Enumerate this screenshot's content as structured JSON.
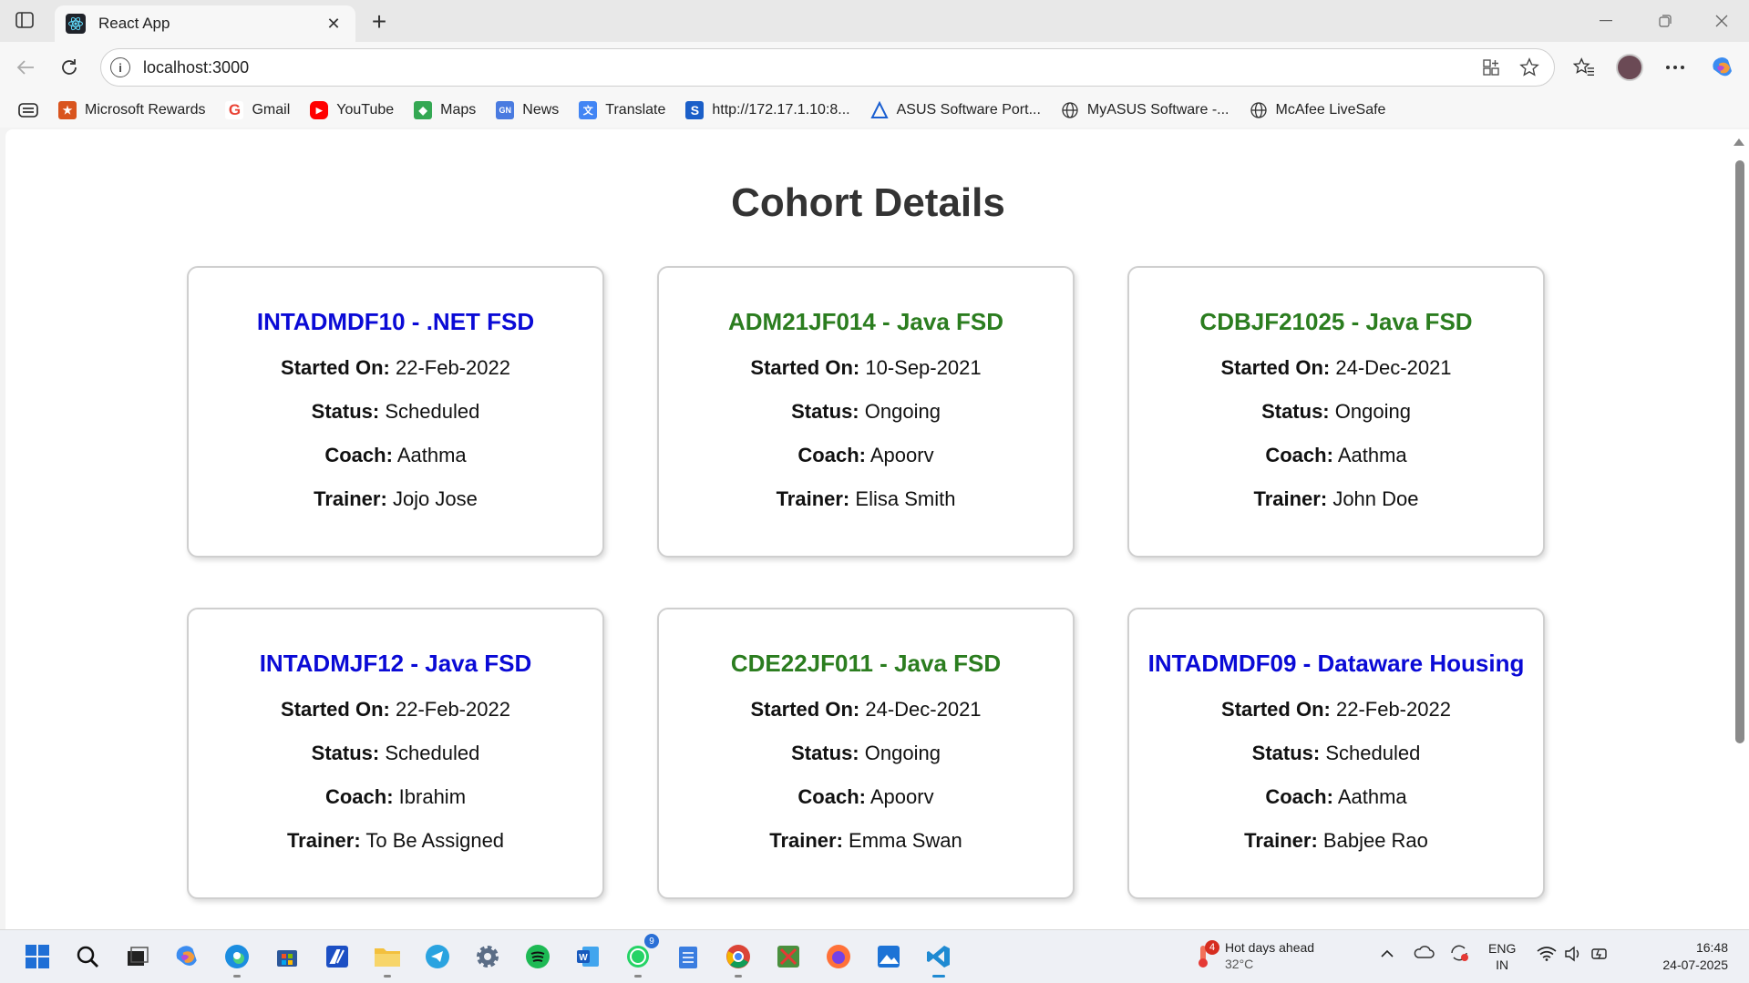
{
  "browser": {
    "tab_title": "React App",
    "url": "localhost:3000",
    "bookmarks": [
      {
        "label": "Microsoft Rewards",
        "icon": "rewards-icon",
        "color": "#d9541e"
      },
      {
        "label": "Gmail",
        "icon": "gmail-icon",
        "color": "#ea4335"
      },
      {
        "label": "YouTube",
        "icon": "youtube-icon",
        "color": "#ff0000"
      },
      {
        "label": "Maps",
        "icon": "maps-icon",
        "color": "#34a853"
      },
      {
        "label": "News",
        "icon": "news-icon",
        "color": "#4a7be0"
      },
      {
        "label": "Translate",
        "icon": "translate-icon",
        "color": "#4285f4"
      },
      {
        "label": "http://172.17.1.10:8...",
        "icon": "s-icon",
        "color": "#1b5fc8"
      },
      {
        "label": "ASUS Software Port...",
        "icon": "asus-icon",
        "color": "#1a5fd1"
      },
      {
        "label": "MyASUS Software -...",
        "icon": "globe-icon",
        "color": "#444444"
      },
      {
        "label": "McAfee LiveSafe",
        "icon": "globe-icon",
        "color": "#444444"
      }
    ]
  },
  "page": {
    "title": "Cohort Details",
    "labels": {
      "started_on": "Started On:",
      "status": "Status:",
      "coach": "Coach:",
      "trainer": "Trainer:"
    },
    "cohorts": [
      {
        "title": "INTADMDF10 - .NET FSD",
        "started_on": "22-Feb-2022",
        "status": "Scheduled",
        "coach": "Aathma",
        "trainer": "Jojo Jose",
        "title_color": "blue"
      },
      {
        "title": "ADM21JF014 - Java FSD",
        "started_on": "10-Sep-2021",
        "status": "Ongoing",
        "coach": "Apoorv",
        "trainer": "Elisa Smith",
        "title_color": "green"
      },
      {
        "title": "CDBJF21025 - Java FSD",
        "started_on": "24-Dec-2021",
        "status": "Ongoing",
        "coach": "Aathma",
        "trainer": "John Doe",
        "title_color": "green"
      },
      {
        "title": "INTADMJF12 - Java FSD",
        "started_on": "22-Feb-2022",
        "status": "Scheduled",
        "coach": "Ibrahim",
        "trainer": "To Be Assigned",
        "title_color": "blue"
      },
      {
        "title": "CDE22JF011 - Java FSD",
        "started_on": "24-Dec-2021",
        "status": "Ongoing",
        "coach": "Apoorv",
        "trainer": "Emma Swan",
        "title_color": "green"
      },
      {
        "title": "INTADMDF09 - Dataware Housing",
        "started_on": "22-Feb-2022",
        "status": "Scheduled",
        "coach": "Aathma",
        "trainer": "Babjee Rao",
        "title_color": "blue"
      }
    ],
    "colors": {
      "scheduled": "#0a0ad6",
      "ongoing": "#2b7d1f"
    }
  },
  "taskbar": {
    "weather_badge": "4",
    "weather_title": "Hot days ahead",
    "weather_temp": "32°C",
    "lang_top": "ENG",
    "lang_bottom": "IN",
    "time": "16:48",
    "date": "24-07-2025",
    "whatsapp_badge": "9"
  }
}
